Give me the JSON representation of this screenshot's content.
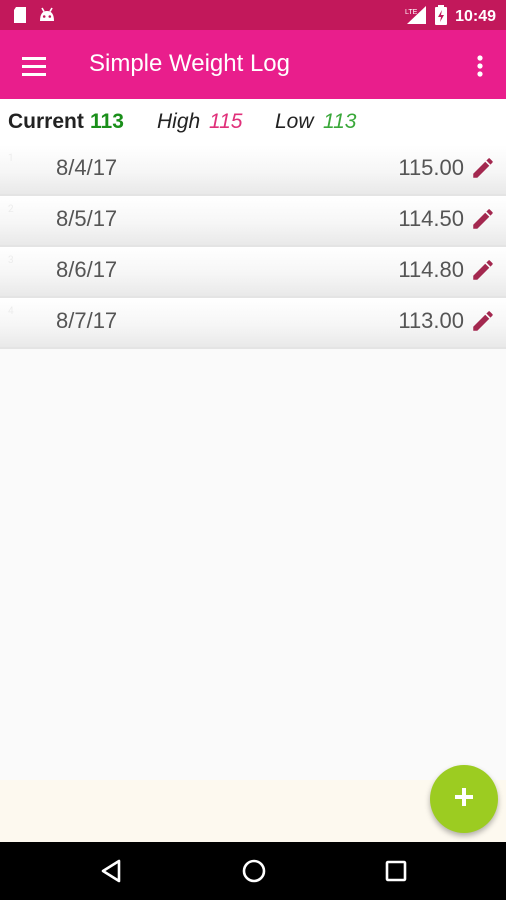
{
  "status_bar": {
    "time": "10:49",
    "network": "LTE"
  },
  "app_bar": {
    "title": "Simple Weight Log"
  },
  "summary": {
    "current_label": "Current",
    "current_value": "113",
    "high_label": "High",
    "high_value": "115",
    "low_label": "Low",
    "low_value": "113"
  },
  "entries": [
    {
      "index": "1",
      "date": "8/4/17",
      "weight": "115.00"
    },
    {
      "index": "2",
      "date": "8/5/17",
      "weight": "114.50"
    },
    {
      "index": "3",
      "date": "8/6/17",
      "weight": "114.80"
    },
    {
      "index": "4",
      "date": "8/7/17",
      "weight": "113.00"
    }
  ],
  "colors": {
    "app_bar": "#e91e8c",
    "status_bar": "#c2185b",
    "current_value": "#1a8f1a",
    "high_value": "#e0307a",
    "low_value": "#3aa83a",
    "edit_icon": "#a3284f",
    "fab": "#9ccc21"
  },
  "icons": {
    "status_left": [
      "sd-card-icon",
      "android-icon"
    ],
    "status_right": [
      "lte-signal-icon",
      "battery-icon"
    ],
    "app_bar": [
      "hamburger-menu-icon",
      "more-vert-icon"
    ],
    "row": "pencil-edit-icon",
    "fab": "plus-icon",
    "nav": [
      "back-icon",
      "home-icon",
      "recents-icon"
    ]
  }
}
